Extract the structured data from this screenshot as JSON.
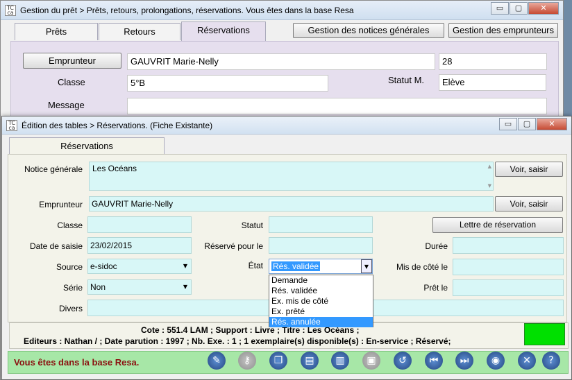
{
  "back_window": {
    "title": "Gestion du prêt > Prêts, retours, prolongations, réservations.  Vous êtes dans la base Resa",
    "tabs": [
      "Prêts",
      "Retours",
      "Réservations"
    ],
    "buttons": {
      "notices": "Gestion des notices générales",
      "emprunteurs": "Gestion des emprunteurs",
      "emprunteur": "Emprunteur"
    },
    "emprunteur_value": "GAUVRIT Marie-Nelly",
    "emprunteur_number": "28",
    "classe_label": "Classe",
    "classe_value": "5°B",
    "statut_label": "Statut M.",
    "statut_value": "Elève",
    "message_label": "Message",
    "message_value": ""
  },
  "front_window": {
    "title": "Édition des tables > Réservations.  (Fiche Existante)",
    "tab": "Réservations",
    "labels": {
      "notice": "Notice générale",
      "emprunteur": "Emprunteur",
      "classe": "Classe",
      "statut": "Statut",
      "date_saisie": "Date de saisie",
      "reserve_pour": "Réservé pour le",
      "duree": "Durée",
      "source": "Source",
      "etat": "État",
      "mis_de_cote": "Mis de côté le",
      "serie": "Série",
      "prete": "Prêt le",
      "divers": "Divers"
    },
    "values": {
      "notice": "Les Océans",
      "emprunteur": "GAUVRIT Marie-Nelly",
      "classe": "",
      "statut": "",
      "date_saisie": "23/02/2015",
      "reserve_pour": "",
      "duree": "",
      "source": "e-sidoc",
      "etat": "Rés. validée",
      "mis_de_cote": "",
      "serie": "Non",
      "prete": "",
      "divers": ""
    },
    "buttons": {
      "voir1": "Voir, saisir",
      "voir2": "Voir, saisir",
      "lettre": "Lettre de réservation"
    },
    "etat_options": [
      "Demande",
      "Rés. validée",
      "Ex. mis de côté",
      "Ex. prêté",
      "Rés. annulée"
    ],
    "etat_highlighted": "Rés. annulée",
    "info_line1": "Cote  : 551.4 LAM ;  Support  : Livre ;  Titre  : Les Océans ;",
    "info_line2": "Editeurs  : Nathan / ;  Date parution  : 1997 ;  Nb. Exe.  : 1 ; 1 exemplaire(s) disponible(s)  :  En-service ;  Réservé;",
    "status": "Vous êtes dans la base Resa.",
    "status_color": "#8b1010",
    "indicator_color": "#00e000"
  },
  "window_controls": {
    "minimize": "▭",
    "maximize": "▢",
    "close": "✕"
  },
  "toolbar_icons": [
    "edit-icon",
    "key-icon",
    "copy-icon",
    "note-icon",
    "trash-icon",
    "save-icon",
    "undo-icon",
    "first-record-icon",
    "last-record-icon",
    "view-icon",
    "close-icon",
    "help-icon"
  ]
}
